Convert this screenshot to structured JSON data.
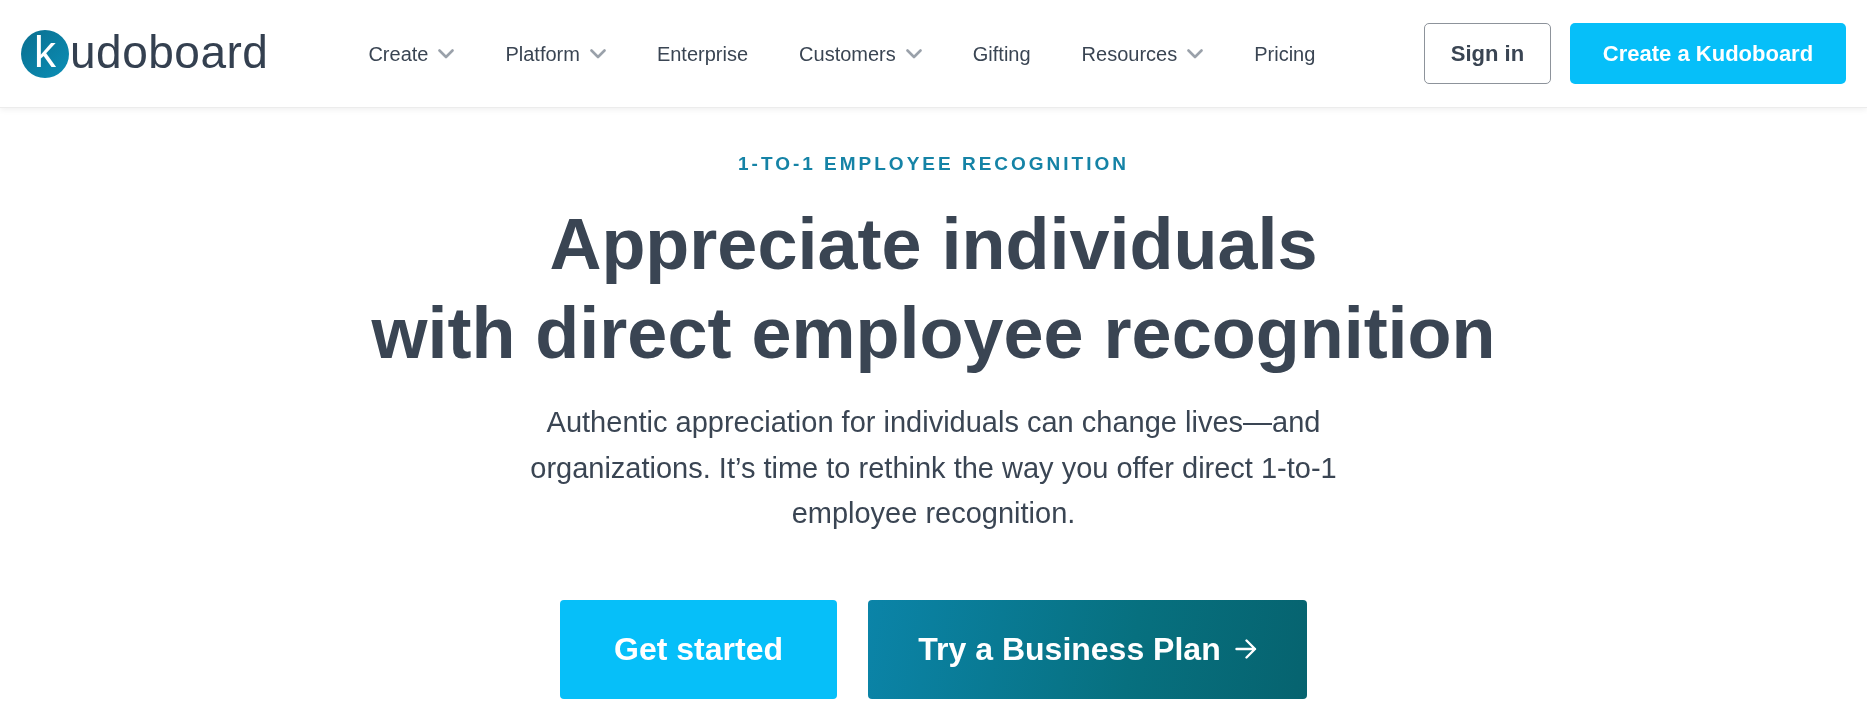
{
  "header": {
    "logo": {
      "letter": "k",
      "wordmark": "udoboard"
    },
    "nav": [
      {
        "label": "Create",
        "dropdown": true
      },
      {
        "label": "Platform",
        "dropdown": true
      },
      {
        "label": "Enterprise",
        "dropdown": false
      },
      {
        "label": "Customers",
        "dropdown": true
      },
      {
        "label": "Gifting",
        "dropdown": false
      },
      {
        "label": "Resources",
        "dropdown": true
      },
      {
        "label": "Pricing",
        "dropdown": false
      }
    ],
    "buttons": [
      {
        "label": "Sign in",
        "kind": "outline"
      },
      {
        "label": "Create a Kudoboard",
        "kind": "primary"
      }
    ]
  },
  "hero": {
    "eyebrow": "1-TO-1 EMPLOYEE RECOGNITION",
    "heading": [
      "Appreciate individuals",
      "with direct employee recognition"
    ],
    "description": "Authentic appreciation for individuals can change lives—and organizations. It’s time to rethink the way you offer direct 1-to-1 employee recognition.",
    "buttons": [
      {
        "label": "Get started",
        "kind": "primary",
        "arrow": false
      },
      {
        "label": "Try a Business Plan",
        "kind": "gradient",
        "arrow": true
      }
    ]
  }
}
